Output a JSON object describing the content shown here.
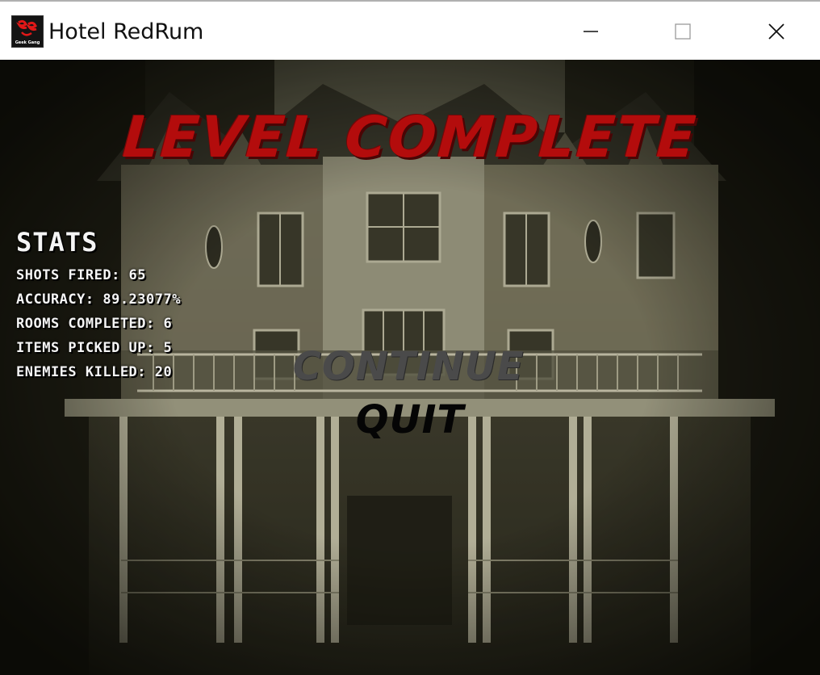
{
  "window": {
    "title": "Hotel RedRum",
    "icon": "geek-gang-logo-icon",
    "minimize_icon": "minimize-icon",
    "maximize_icon": "maximize-icon",
    "close_icon": "close-icon",
    "icon_logo_text": "Geek Gang"
  },
  "game": {
    "title": "LEVEL COMPLETE",
    "title_color": "#b30c0c",
    "stats": {
      "heading": "STATS",
      "lines": [
        "SHOTS FIRED: 65",
        "ACCURACY: 89.23077%",
        "ROOMS COMPLETED: 6",
        "ITEMS PICKED UP: 5",
        "ENEMIES KILLED: 20"
      ]
    },
    "menu": {
      "continue_label": "CONTINUE",
      "continue_color": "#4a4a4a",
      "quit_label": "QUIT",
      "quit_color": "#050505"
    },
    "background": "haunted-hotel-facade"
  }
}
